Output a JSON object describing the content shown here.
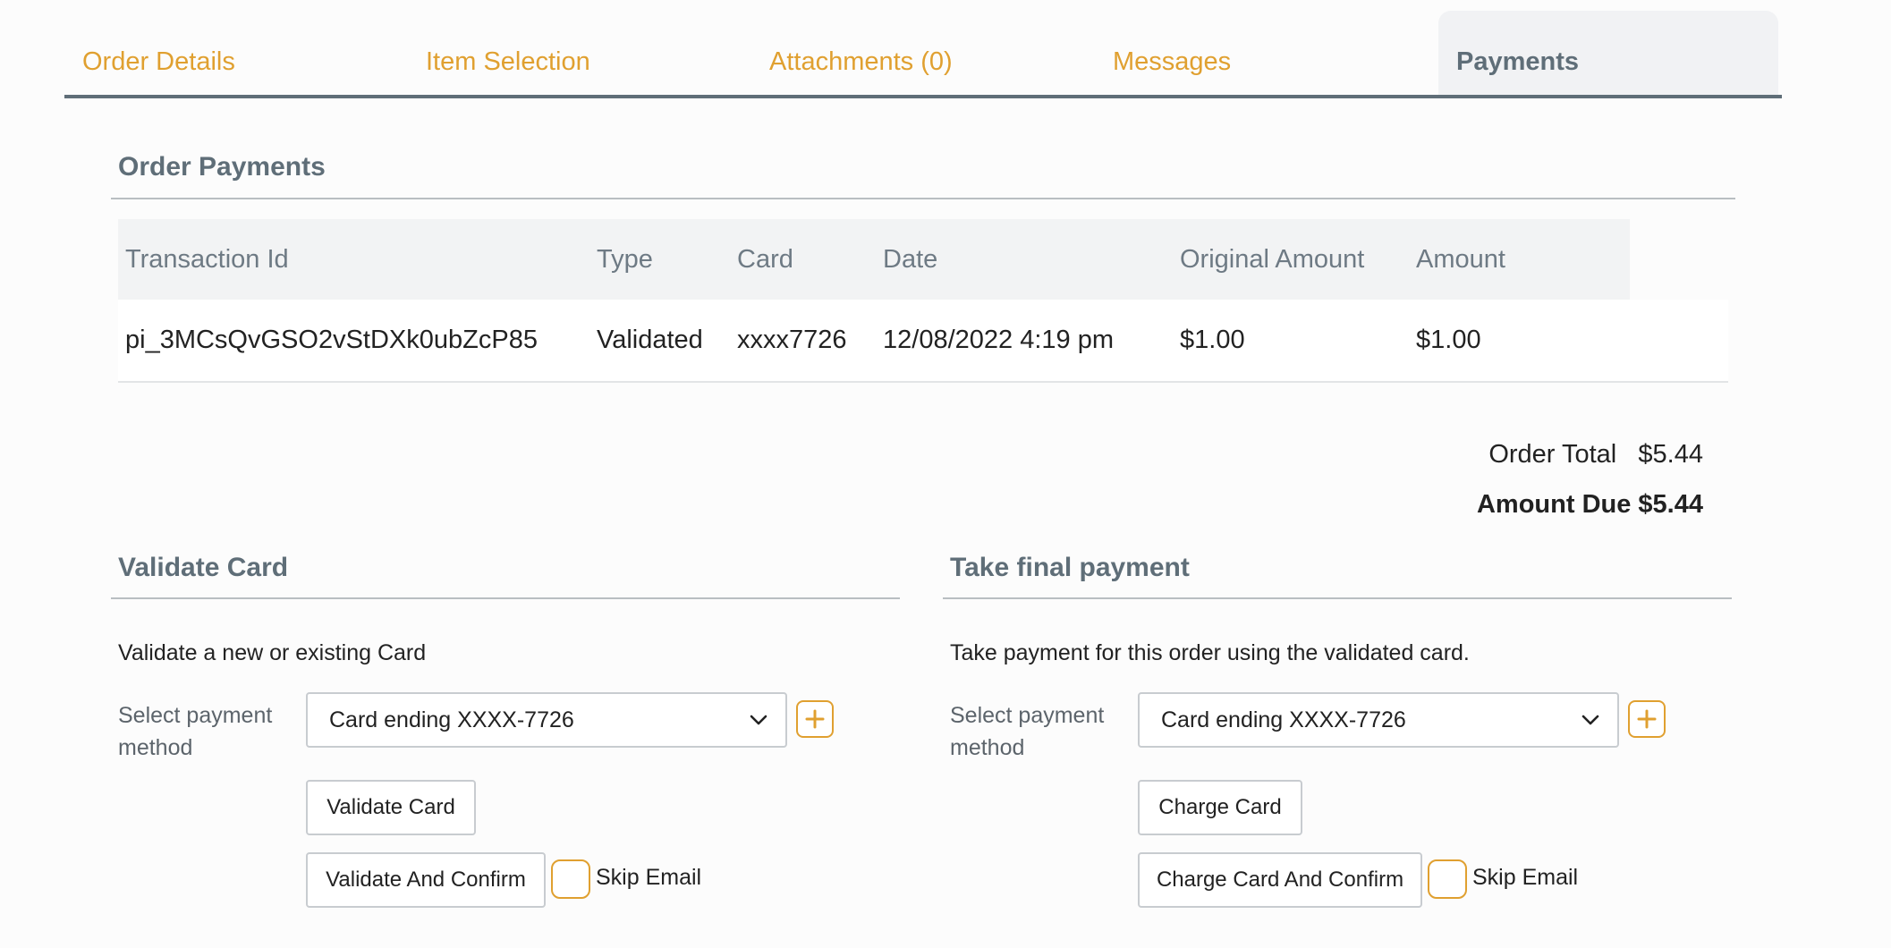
{
  "tabs": [
    {
      "label": "Order Details"
    },
    {
      "label": "Item Selection"
    },
    {
      "label": "Attachments (0)"
    },
    {
      "label": "Messages"
    },
    {
      "label": "Payments"
    }
  ],
  "payments": {
    "title": "Order Payments",
    "columns": [
      "Transaction Id",
      "Type",
      "Card",
      "Date",
      "Original Amount",
      "Amount"
    ],
    "rows": [
      [
        "pi_3MCsQvGSO2vStDXk0ubZcP85",
        "Validated",
        "xxxx7726",
        "12/08/2022 4:19 pm",
        "$1.00",
        "$1.00"
      ]
    ]
  },
  "totals": {
    "order_total_label": "Order Total",
    "order_total_value": "$5.44",
    "amount_due_label": "Amount Due",
    "amount_due_value": "$5.44"
  },
  "validate": {
    "title": "Validate Card",
    "description": "Validate a new or existing Card",
    "select_label": "Select payment method",
    "selected_card": "Card ending XXXX-7726",
    "button": "Validate Card",
    "confirm_button": "Validate And Confirm",
    "skip_email": "Skip Email"
  },
  "final": {
    "title": "Take final payment",
    "description": "Take payment for this order using the validated card.",
    "select_label": "Select payment method",
    "selected_card": "Card ending XXXX-7726",
    "button": "Charge Card",
    "confirm_button": "Charge Card And Confirm",
    "skip_email": "Skip Email"
  },
  "colors": {
    "accent": "#e0a030",
    "heading": "#5f6e78"
  }
}
